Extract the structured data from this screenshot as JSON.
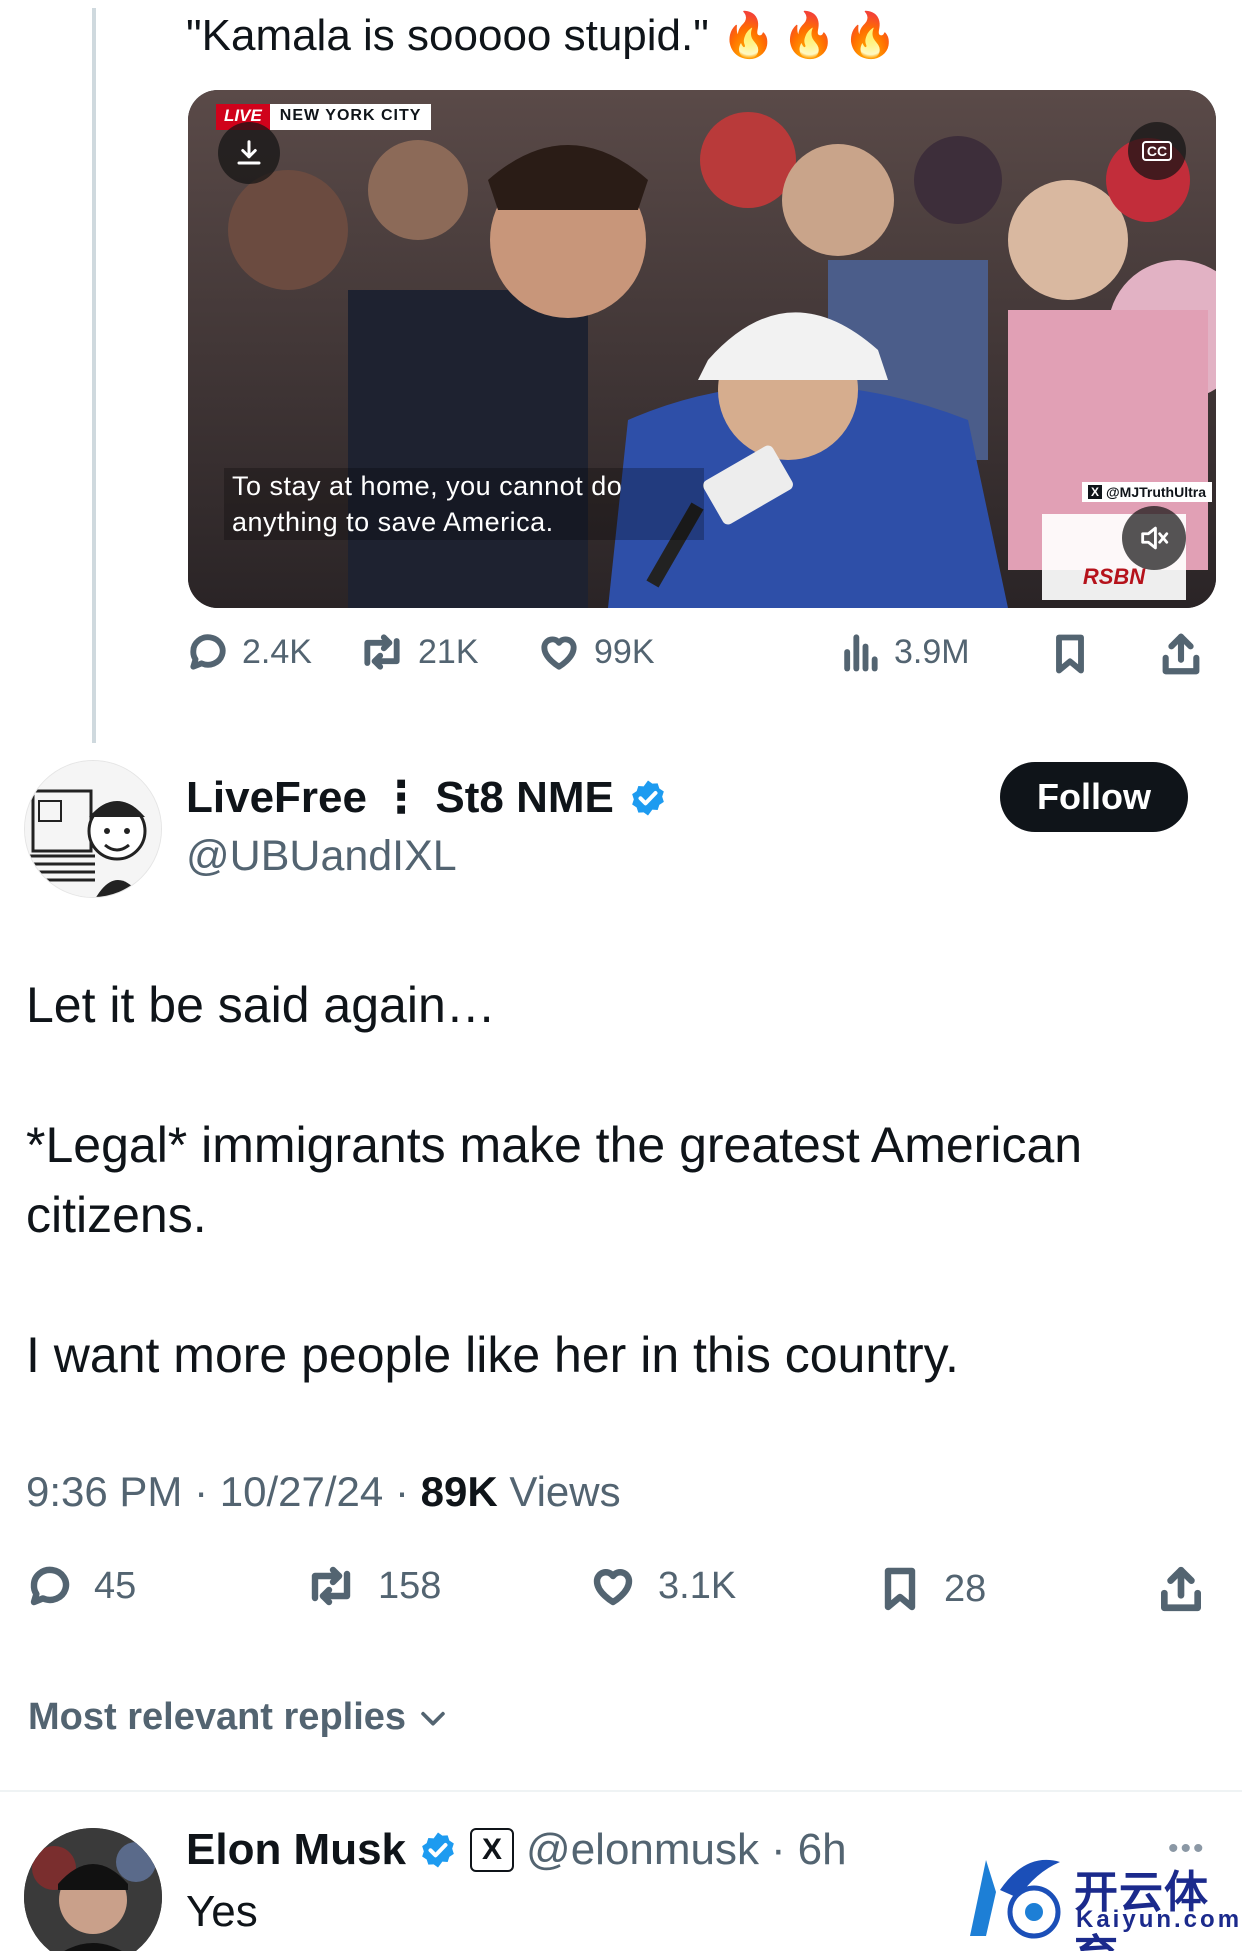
{
  "quoted_tweet": {
    "text": "\"Kamala is sooooo stupid.\"",
    "emoji": "🔥🔥🔥",
    "video": {
      "live_label": "LIVE",
      "location_label": "NEW YORK CITY",
      "caption_line1": "To stay at home, you cannot do",
      "caption_line2": "anything to save America.",
      "watermark": "@MJTruthUltra",
      "watermark_x": "X",
      "broadcaster_logo": "RSBN",
      "cc_label": "CC",
      "icons": [
        "download-icon",
        "closed-captions-icon",
        "muted-volume-icon"
      ]
    },
    "actions": {
      "replies": "2.4K",
      "reposts": "21K",
      "likes": "99K",
      "views": "3.9M"
    }
  },
  "tweet": {
    "author_name": "LiveFree ⋮ St8 NME",
    "handle": "@UBUandIXL",
    "follow_label": "Follow",
    "body": {
      "line1": "Let it be said again…",
      "line2": "*Legal* immigrants make the greatest American citizens.",
      "line3": "I want more people like her in this country."
    },
    "meta": {
      "time": "9:36 PM",
      "date": "10/27/24",
      "views_count": "89K",
      "views_label": "Views",
      "separator": "·"
    },
    "actions": {
      "replies": "45",
      "reposts": "158",
      "likes": "3.1K",
      "bookmarks": "28"
    }
  },
  "replies_section": {
    "sort_label": "Most relevant replies"
  },
  "reply": {
    "author_name": "Elon Musk",
    "handle": "@elonmusk",
    "time": "6h",
    "separator": "·",
    "x_badge": "X",
    "text": "Yes",
    "more": "•••"
  },
  "site_watermark": {
    "cn": "开云体育",
    "en": "Kaiyun.com"
  },
  "colors": {
    "verified_blue": "#1d9bf0",
    "text_primary": "#0f1419",
    "text_secondary": "#536471"
  }
}
